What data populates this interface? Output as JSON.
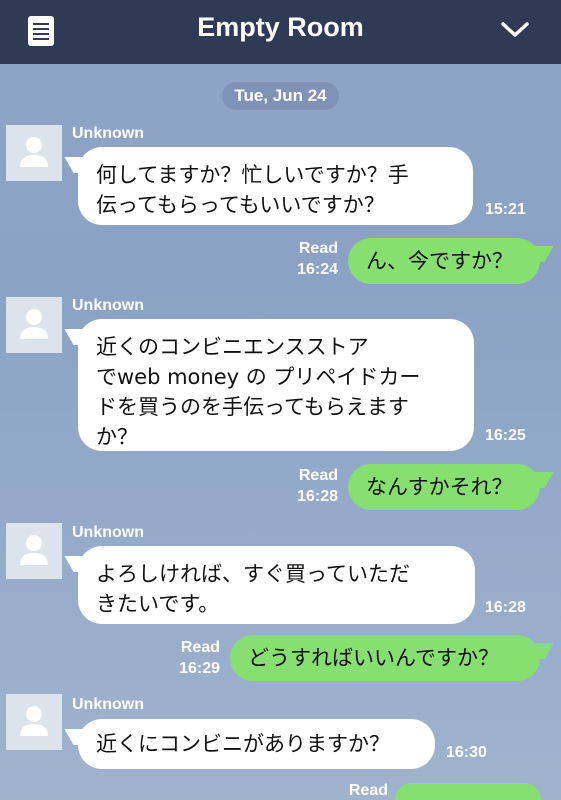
{
  "header": {
    "title": "Empty Room",
    "menu_icon": "list-icon",
    "collapse_icon": "chevron-down-icon"
  },
  "date_label": "Tue, Jun 24",
  "read_label": "Read",
  "messages": [
    {
      "direction": "in",
      "sender": "Unknown",
      "lines": [
        "何してますか？忙しいですか？手",
        "伝ってもらってもいいですか？"
      ],
      "time": "15:21"
    },
    {
      "direction": "out",
      "text": "ん、今ですか？",
      "time": "16:24"
    },
    {
      "direction": "in",
      "sender": "Unknown",
      "lines": [
        "近くのコンビニエンスストア",
        "でweb money の プリペイドカー",
        "ドを買うのを手伝ってもらえます",
        "か？"
      ],
      "time": "16:25"
    },
    {
      "direction": "out",
      "text": "なんすかそれ？",
      "time": "16:28"
    },
    {
      "direction": "in",
      "sender": "Unknown",
      "lines": [
        "よろしければ、すぐ買っていただ",
        "きたいです。"
      ],
      "time": "16:28"
    },
    {
      "direction": "out",
      "text": "どうすればいいんですか？",
      "time": "16:29"
    },
    {
      "direction": "in",
      "sender": "Unknown",
      "lines": [
        "近くにコンビニがありますか？"
      ],
      "time": "16:30"
    }
  ],
  "colors": {
    "header": "#2f3b54",
    "outgoing_bubble": "#87df72",
    "background": "#8fa5c7"
  }
}
